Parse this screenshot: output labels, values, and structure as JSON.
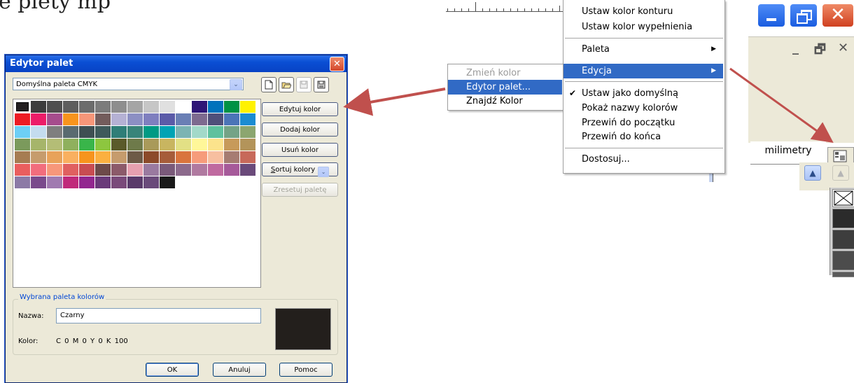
{
  "caption": "e plety mp",
  "dialog": {
    "title": "Edytor palet",
    "palette_select": "Domyślna paleta CMYK",
    "buttons": {
      "edit": "Edytuj kolor",
      "add": "Dodaj kolor",
      "remove": "Usuń kolor",
      "sort_u": "S",
      "sort_rest": "ortuj kolory",
      "reset": "Zresetuj paletę"
    },
    "group_label": "Wybrana paleta kolorów",
    "name_label": "Nazwa:",
    "name_value": "Czarny",
    "color_label": "Kolor:",
    "color_value": "C 0   M 0   Y 0   K 100",
    "ok": "OK",
    "cancel": "Anuluj",
    "help": "Pomoc",
    "swatches": [
      "#231f20",
      "#3d3d3d",
      "#4f4f4f",
      "#5e5e5e",
      "#6c6c6c",
      "#7c7c7c",
      "#8e8e8e",
      "#a5a5a5",
      "#c6c6c6",
      "#e0e0e0",
      "#ffffff",
      "#2e1577",
      "#0072bc",
      "#009245",
      "#fff200",
      "#ed1c24",
      "#ec1c68",
      "#a64c8d",
      "#f7941d",
      "#f69679",
      "#735c5c",
      "#b5b1d4",
      "#8c8fc3",
      "#7f7fbf",
      "#5b5ba8",
      "#6a7fb5",
      "#7d6a8f",
      "#4f4f7a",
      "#4b74b7",
      "#1b8cd1",
      "#6dcff6",
      "#c4dcef",
      "#7f7f7f",
      "#5a6b70",
      "#3e4f52",
      "#3e5a5b",
      "#2f7e78",
      "#388479",
      "#009a84",
      "#00a3b4",
      "#7bb4b3",
      "#a3d9c9",
      "#5fc19e",
      "#74a387",
      "#8ca66f",
      "#7b9a5c",
      "#a6b56a",
      "#b4bd76",
      "#8fb05d",
      "#39b54a",
      "#8dc63f",
      "#5a5a2a",
      "#6e7a4a",
      "#a99a5a",
      "#c8b560",
      "#e2e085",
      "#fff799",
      "#fbe38c",
      "#c79a5a",
      "#b3945a",
      "#a67c52",
      "#c69c6d",
      "#e8a25a",
      "#f9b060",
      "#f7941d",
      "#fbb040",
      "#c69c6d",
      "#6d5a47",
      "#8c4a2a",
      "#a65c3a",
      "#d9743d",
      "#f69c7b",
      "#f7bfa0",
      "#a67c72",
      "#c7695a",
      "#ea5e5e",
      "#f26d7d",
      "#f7977a",
      "#e06060",
      "#c84c52",
      "#6d4a4a",
      "#8c5a6a",
      "#e6a0b0",
      "#9a7aa0",
      "#7a5a7a",
      "#8c6a8c",
      "#b07aa0",
      "#c06aa0",
      "#a65a9a",
      "#6a4a7a",
      "#8c7aa6",
      "#7a4a8c",
      "#a07ab0",
      "#c02a7a",
      "#92278f",
      "#6a3a7a",
      "#7a4a7a",
      "#5a3a6a",
      "#6a4a7a",
      "#1a1a1a"
    ]
  },
  "submenu": {
    "items": [
      "Zmień kolor",
      "Edytor palet...",
      "Znajdź Kolor"
    ]
  },
  "menu": {
    "items": [
      "Ustaw kolor konturu",
      "Ustaw kolor wypełnienia",
      "Paleta",
      "Edycja",
      "Ustaw jako domyślną",
      "Pokaż nazwy kolorów",
      "Przewiń do początku",
      "Przewiń do końca",
      "Dostosuj..."
    ]
  },
  "right_panel": {
    "ruler_unit": "milimetry"
  },
  "colors": {
    "highlight": "#316ac5",
    "arrow": "#c0504d",
    "dialog_bg": "#ece9d8",
    "title_blue": "#0a4fd4"
  }
}
